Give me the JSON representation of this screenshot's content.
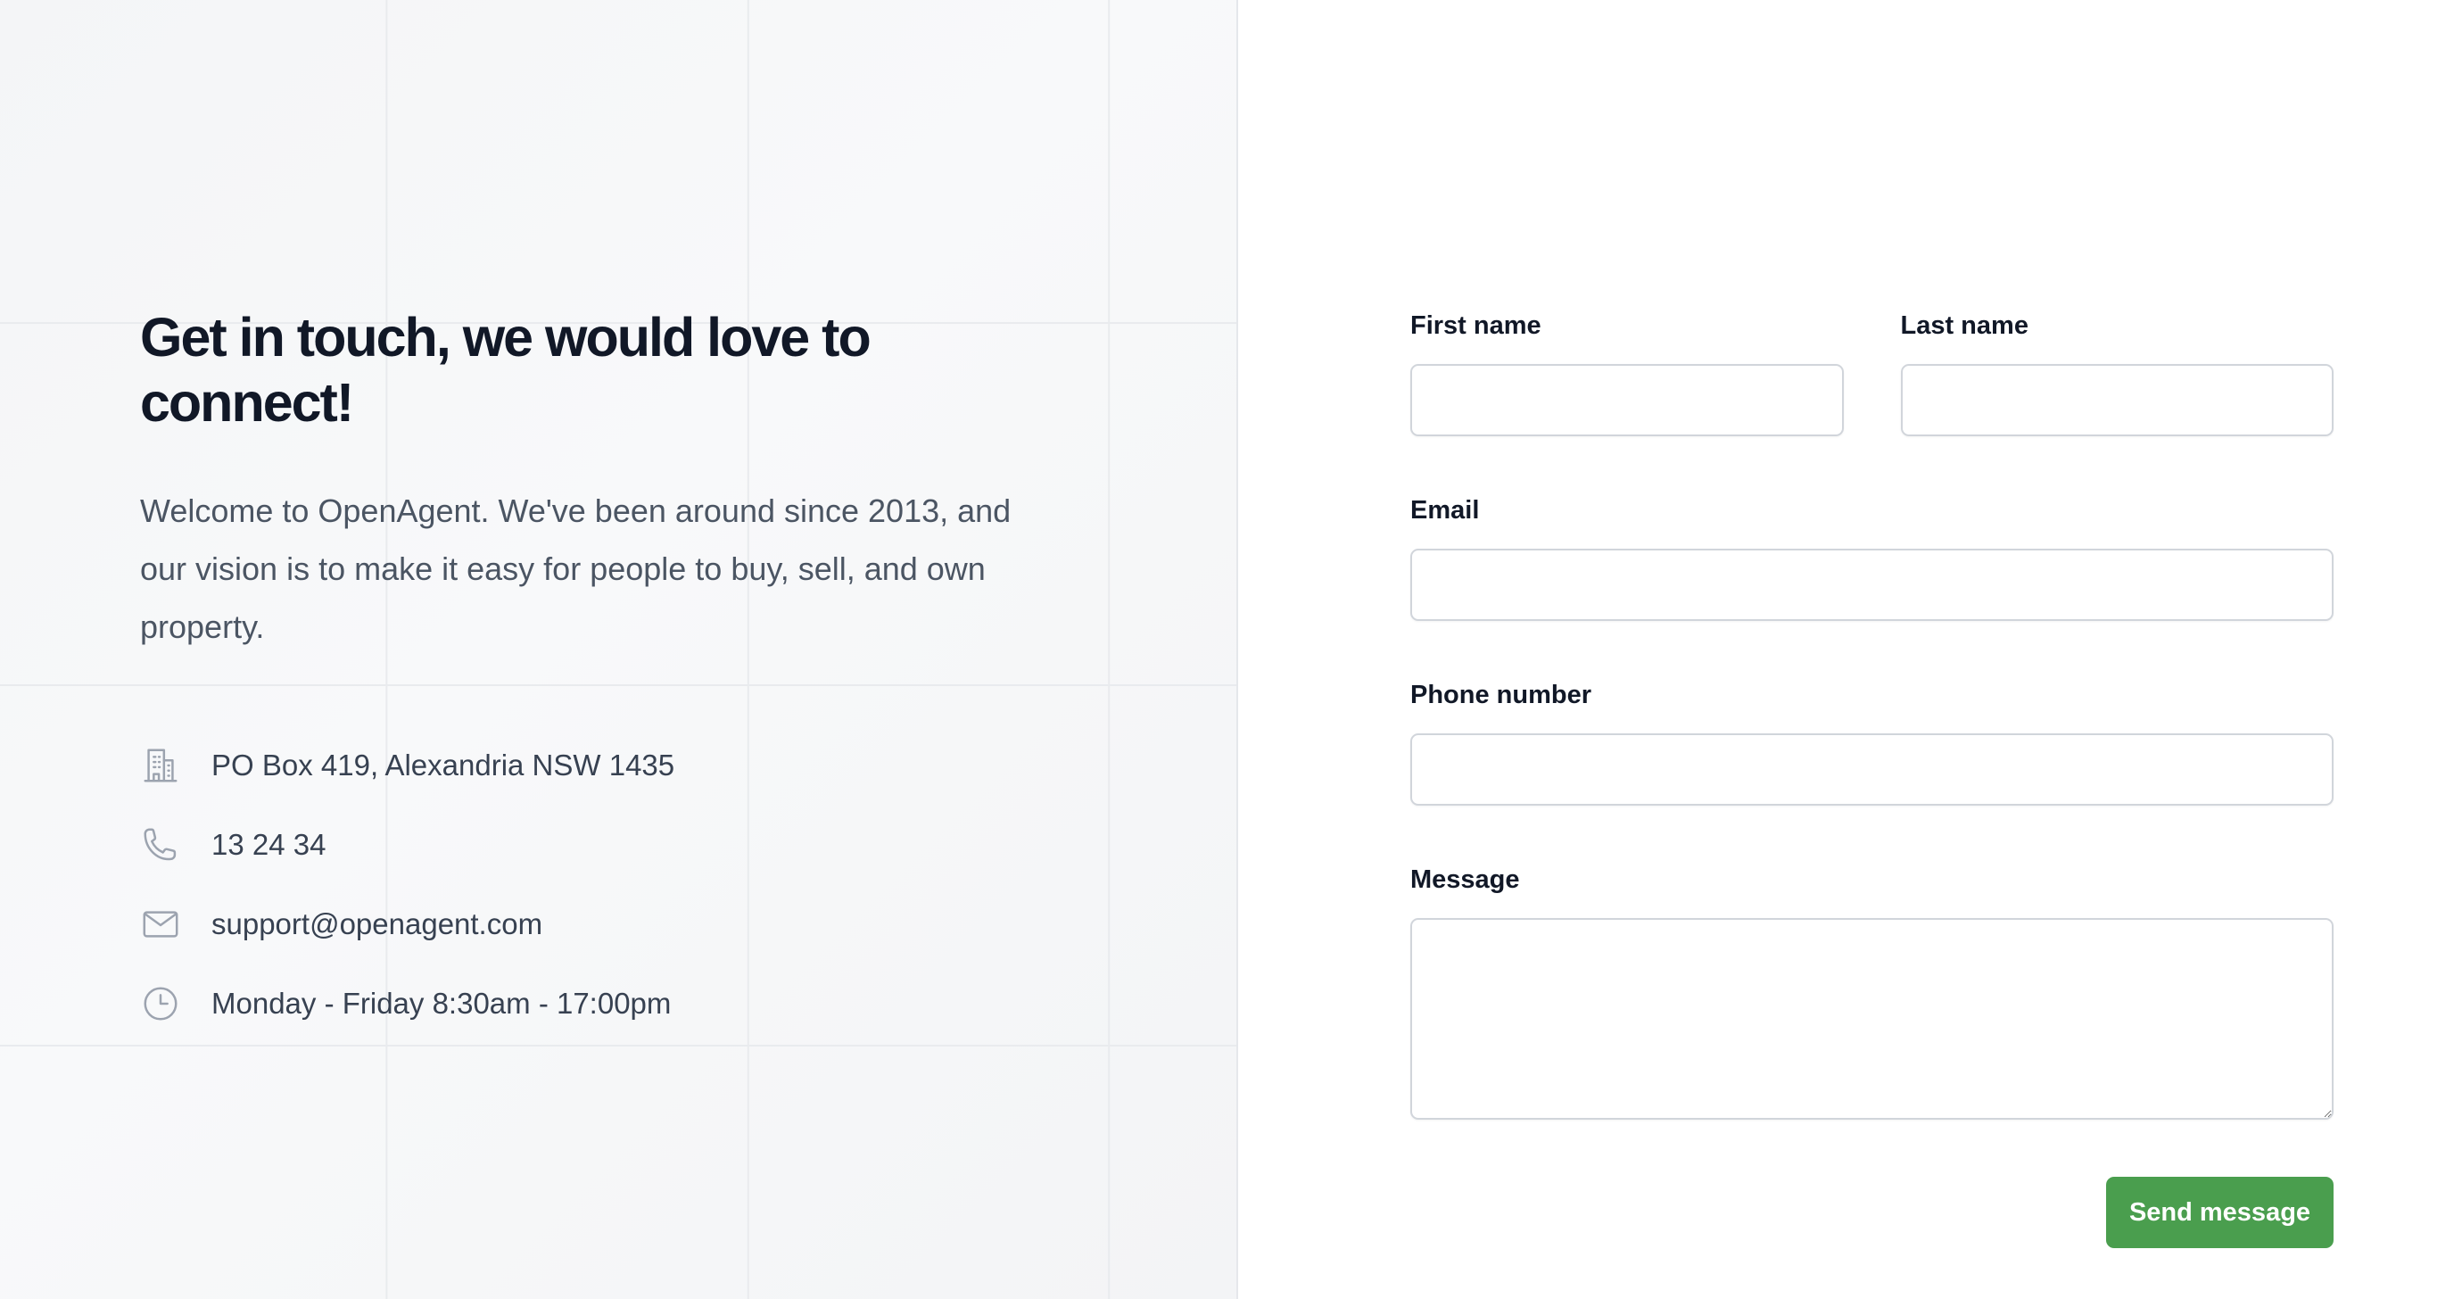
{
  "contact": {
    "heading": "Get in touch, we would love to connect!",
    "intro": "Welcome to OpenAgent. We've been around since 2013, and our vision is to make it easy for people to buy, sell, and own property.",
    "items": [
      {
        "icon": "building-icon",
        "text": "PO Box 419, Alexandria NSW 1435"
      },
      {
        "icon": "phone-icon",
        "text": "13 24 34"
      },
      {
        "icon": "envelope-icon",
        "text": "support@openagent.com"
      },
      {
        "icon": "clock-icon",
        "text": "Monday - Friday 8:30am - 17:00pm"
      }
    ]
  },
  "form": {
    "first_name_label": "First name",
    "first_name_value": "",
    "last_name_label": "Last name",
    "last_name_value": "",
    "email_label": "Email",
    "email_value": "",
    "phone_label": "Phone number",
    "phone_value": "",
    "message_label": "Message",
    "message_value": "",
    "submit_label": "Send message"
  },
  "colors": {
    "accent": "#4a9e4e",
    "heading": "#111827",
    "body_text": "#4b5563",
    "left_panel_bg": "#f5f6f8"
  }
}
